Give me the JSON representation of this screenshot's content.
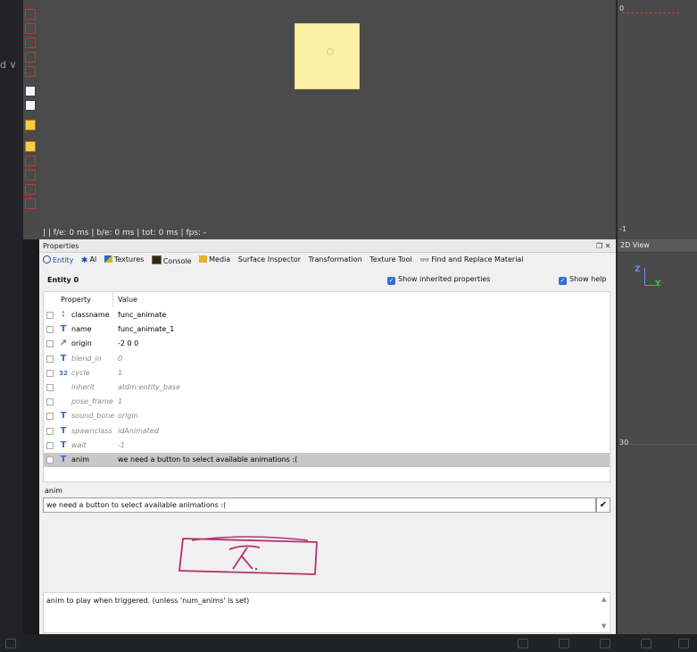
{
  "left_strip": {
    "fragment": "d ∨"
  },
  "viewport": {
    "stats": "| | f/e: 0 ms | b/e: 0 ms | tot: 0 ms | fps: -"
  },
  "top_view": {
    "ruler_top": "0",
    "ruler_bottom": "-1"
  },
  "view_2d": {
    "title": "2D View",
    "ruler_mark": "30",
    "axis_z": "Z",
    "axis_y": "Y"
  },
  "properties": {
    "title": "Properties",
    "window_controls": "❐ ✕",
    "tabs": [
      {
        "label": "Entity",
        "icon": "entity-icon"
      },
      {
        "label": "AI",
        "icon": "ai-icon"
      },
      {
        "label": "Textures",
        "icon": "textures-icon"
      },
      {
        "label": "Console",
        "icon": "console-icon"
      },
      {
        "label": "Media",
        "icon": "folder-icon"
      },
      {
        "label": "Surface Inspector"
      },
      {
        "label": "Transformation"
      },
      {
        "label": "Texture Tool"
      },
      {
        "label": "Find and Replace Material",
        "icon": "binoculars-icon"
      }
    ],
    "entity_heading": "Entity 0",
    "show_inherited_label": "Show inherited properties",
    "show_help_label": "Show help",
    "columns": {
      "property": "Property",
      "value": "Value"
    },
    "rows": [
      {
        "icon": "classname-icon",
        "glyph": "∶",
        "property": "classname",
        "value": "func_animate",
        "inherited": false
      },
      {
        "icon": "text-type-icon",
        "glyph": "T",
        "property": "name",
        "value": "func_animate_1",
        "inherited": false
      },
      {
        "icon": "vector-type-icon",
        "glyph": "↗",
        "property": "origin",
        "value": "-2 0 0",
        "inherited": false
      },
      {
        "icon": "text-type-icon",
        "glyph": "T",
        "property": "blend_in",
        "value": "0",
        "inherited": true
      },
      {
        "icon": "int-type-icon",
        "glyph": "32",
        "property": "cycle",
        "value": "1",
        "inherited": true
      },
      {
        "icon": "",
        "glyph": "",
        "property": "inherit",
        "value": "atdm:entity_base",
        "inherited": true
      },
      {
        "icon": "",
        "glyph": "",
        "property": "pose_frame",
        "value": "1",
        "inherited": true
      },
      {
        "icon": "text-type-icon",
        "glyph": "T",
        "property": "sound_bone",
        "value": "origin",
        "inherited": true
      },
      {
        "icon": "text-type-icon",
        "glyph": "T",
        "property": "spawnclass",
        "value": "idAnimated",
        "inherited": true
      },
      {
        "icon": "text-type-icon",
        "glyph": "T",
        "property": "wait",
        "value": "-1",
        "inherited": true
      },
      {
        "icon": "text-type-icon",
        "glyph": "T",
        "property": "anim",
        "value": "we need a button to select available animations :(",
        "inherited": false,
        "selected": true
      }
    ],
    "key_label": "anim",
    "value_input": "we need a button to select available animations :(",
    "confirm_glyph": "✔",
    "help_text": "anim to play when triggered.  (unless 'num_anims' is set)"
  },
  "colors": {
    "viewport": "#4b4b4b",
    "entity_box": "#fcf0a7",
    "accent_blue": "#2f6fd6",
    "annotation": "#b0336e"
  }
}
